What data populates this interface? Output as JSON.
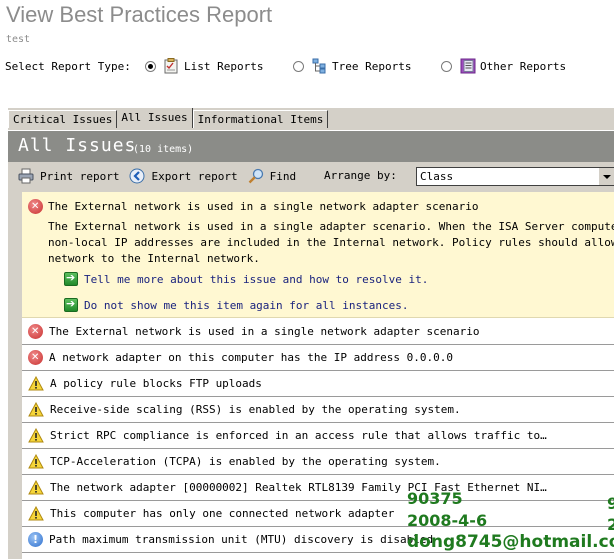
{
  "page": {
    "title": "View Best Practices Report",
    "subtitle": "test"
  },
  "report_type": {
    "label": "Select Report Type:",
    "options": [
      {
        "label": "List Reports",
        "selected": true,
        "icon": "list-report-icon"
      },
      {
        "label": "Tree Reports",
        "selected": false,
        "icon": "tree-report-icon"
      },
      {
        "label": "Other Reports",
        "selected": false,
        "icon": "other-report-icon"
      }
    ]
  },
  "tabs": [
    {
      "label": "Critical Issues",
      "active": false
    },
    {
      "label": "All Issues",
      "active": true
    },
    {
      "label": "Informational Items",
      "active": false
    }
  ],
  "header": {
    "title": "All Issues",
    "count": "(10 items)"
  },
  "toolbar": {
    "print_label": "Print report",
    "export_label": "Export report",
    "find_label": "Find",
    "arrange_label": "Arrange by:",
    "arrange_value": "Class"
  },
  "expanded_item": {
    "severity": "error",
    "title": "The External network is used in a single network adapter scenario",
    "body_lines": [
      "The External network is used in a single adapter scenario. When the ISA Server computer has only",
      "non-local IP addresses are included in the Internal network. Policy rules should allow or deny",
      "network to the Internal network."
    ],
    "links": [
      "Tell me more about this issue and how to resolve it.",
      "Do not show me this item again for all instances."
    ]
  },
  "items": [
    {
      "severity": "error",
      "text": "The External network is used in a single network adapter scenario"
    },
    {
      "severity": "error",
      "text": "A network adapter on this computer has the IP address 0.0.0.0"
    },
    {
      "severity": "warning",
      "text": "A policy rule blocks FTP uploads"
    },
    {
      "severity": "warning",
      "text": "Receive-side scaling (RSS) is enabled by the operating system."
    },
    {
      "severity": "warning",
      "text": "Strict RPC compliance is enforced in an access rule that allows traffic to…"
    },
    {
      "severity": "warning",
      "text": "TCP-Acceleration (TCPA) is enabled by the operating system."
    },
    {
      "severity": "warning",
      "text": "The network adapter [00000002] Realtek RTL8139 Family PCI Fast Ethernet NI…"
    },
    {
      "severity": "warning",
      "text": "This computer has only one connected network adapter"
    },
    {
      "severity": "info",
      "text": "Path maximum transmission unit (MTU) discovery is disabled"
    }
  ],
  "watermark": {
    "line1": "90375",
    "line2": "2008-4-6",
    "line3": "dong8745@hotmail.com"
  },
  "colors": {
    "header_band": "#8b8c88",
    "expanded_bg": "#fff8d2",
    "link": "#1a237e",
    "watermark": "#1f7a1f"
  }
}
